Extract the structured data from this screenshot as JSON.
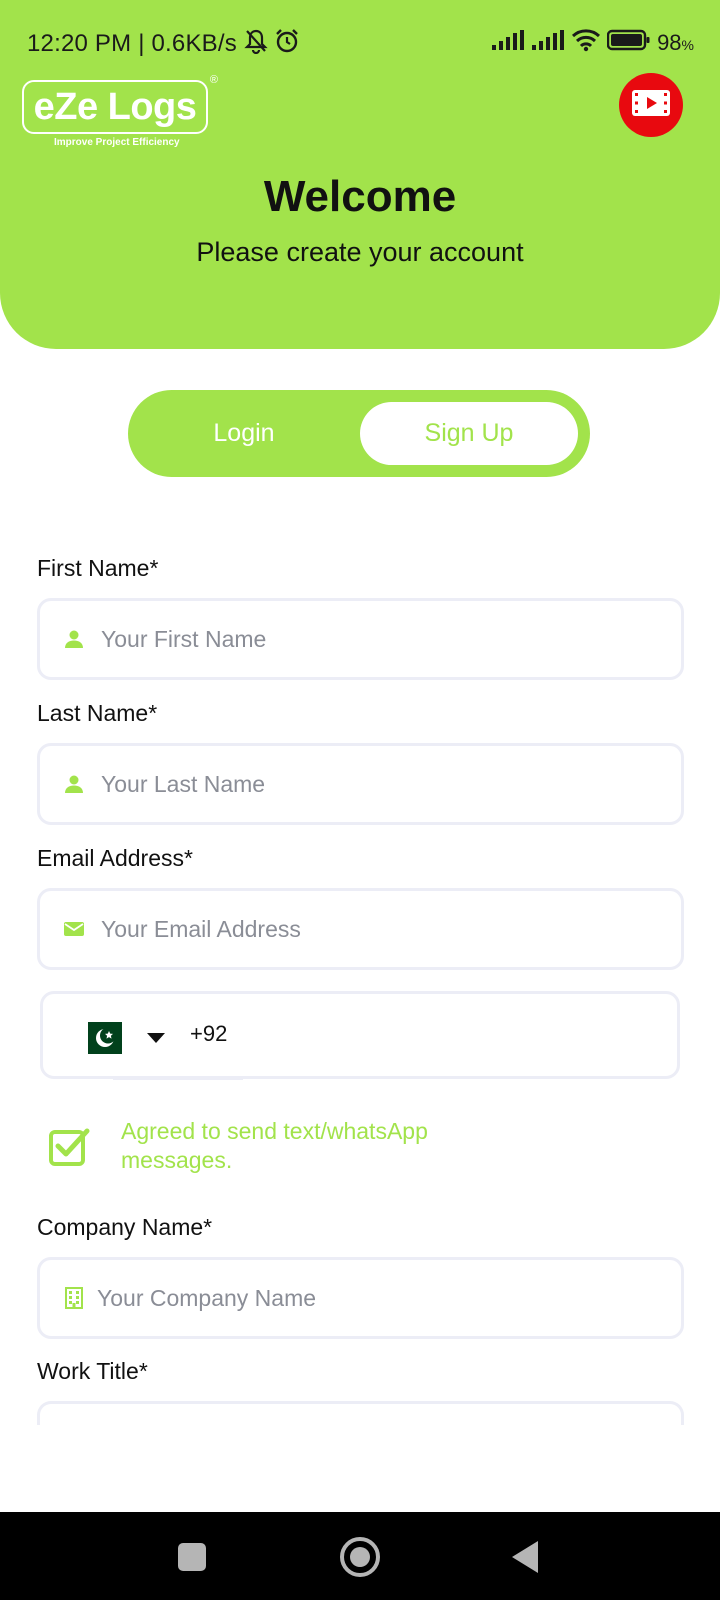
{
  "status_bar": {
    "time": "12:20 PM | 0.6KB/s",
    "battery": "98",
    "battery_unit": "%",
    "icons": [
      "bell-off-icon",
      "alarm-icon",
      "signal-icon",
      "signal-icon",
      "wifi-icon",
      "battery-icon"
    ]
  },
  "header": {
    "logo_text": "eZe Logs",
    "logo_reg": "®",
    "logo_tagline": "Improve Project Efficiency",
    "video_icon": "video-tutorial-icon",
    "title": "Welcome",
    "subtitle": "Please create your account"
  },
  "tabs": {
    "login": "Login",
    "signup": "Sign Up",
    "active": "signup"
  },
  "form": {
    "first_name": {
      "label": "First Name*",
      "placeholder": "Your First Name",
      "icon": "person-icon"
    },
    "last_name": {
      "label": "Last Name*",
      "placeholder": "Your Last Name",
      "icon": "person-icon"
    },
    "email": {
      "label": "Email Address*",
      "placeholder": "Your Email Address",
      "icon": "mail-icon"
    },
    "phone": {
      "country_flag": "pakistan-flag-icon",
      "code": "+92"
    },
    "agree": {
      "text": "Agreed to send text/whatsApp messages.",
      "checked": true
    },
    "company": {
      "label": "Company Name*",
      "placeholder": "Your Company Name",
      "icon": "building-icon"
    },
    "work_title": {
      "label": "Work Title*"
    }
  },
  "colors": {
    "brand": "#a2e34b",
    "video_red": "#e8090f",
    "field_border": "#ecedf6"
  }
}
